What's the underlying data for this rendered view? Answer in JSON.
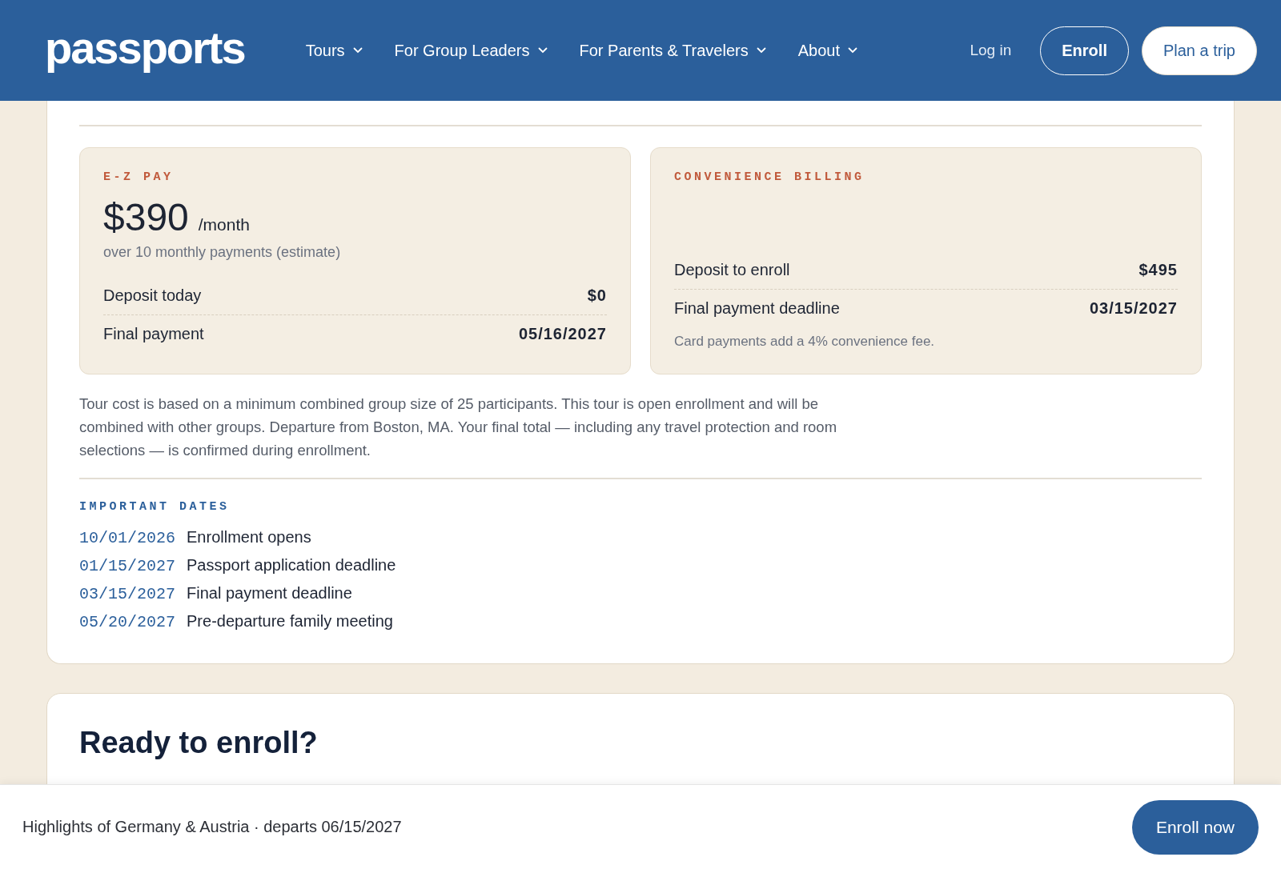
{
  "header": {
    "logo": "passports",
    "nav": [
      {
        "label": "Tours"
      },
      {
        "label": "For Group Leaders"
      },
      {
        "label": "For Parents & Travelers"
      },
      {
        "label": "About"
      }
    ],
    "login": "Log in",
    "enroll": "Enroll",
    "plan_trip": "Plan a trip"
  },
  "plans": [
    {
      "kind": "estimate",
      "label": "E-Z PAY",
      "price": "$390",
      "unit": "/month",
      "note": "over 10 monthly payments (estimate)",
      "rows": [
        {
          "label": "Deposit today",
          "value": "$0"
        },
        {
          "label": "Final payment",
          "value": "05/16/2027"
        }
      ]
    },
    {
      "kind": "fixed",
      "label": "CONVENIENCE BILLING",
      "rows": [
        {
          "label": "Deposit to enroll",
          "value": "$495"
        },
        {
          "label": "Final payment deadline",
          "value": "03/15/2027"
        }
      ],
      "note": "Card payments add a 4% convenience fee."
    }
  ],
  "disclaimer": "Tour cost is based on a minimum combined group size of 25 participants. This tour is open enrollment and will be combined with other groups. Departure from Boston, MA. Your final total — including any travel protection and room selections — is confirmed during enrollment.",
  "dates": {
    "title": "IMPORTANT DATES",
    "items": [
      {
        "date": "10/01/2026",
        "event": "Enrollment opens"
      },
      {
        "date": "01/15/2027",
        "event": "Passport application deadline"
      },
      {
        "date": "03/15/2027",
        "event": "Final payment deadline"
      },
      {
        "date": "05/20/2027",
        "event": "Pre-departure family meeting"
      }
    ]
  },
  "next_section": {
    "title": "Ready to enroll?"
  },
  "bottom_bar": {
    "text": "Highlights of Germany & Austria · departs 06/15/2027",
    "button": "Enroll now"
  }
}
